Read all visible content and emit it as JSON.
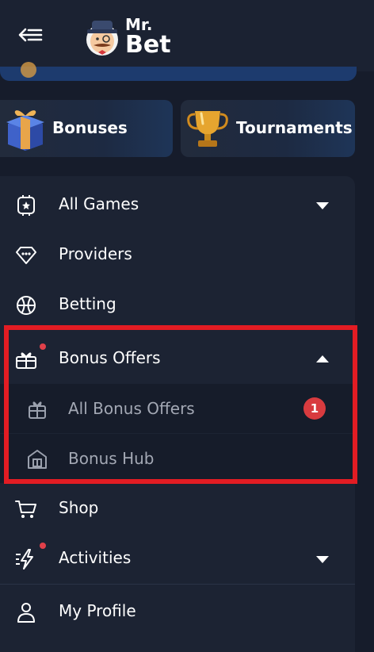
{
  "header": {
    "logo_line1": "Mr.",
    "logo_line2": "Bet"
  },
  "promos": [
    {
      "label": "Bonuses",
      "icon": "gift-box-icon"
    },
    {
      "label": "Tournaments",
      "icon": "trophy-icon"
    }
  ],
  "menu": {
    "all_games": "All Games",
    "providers": "Providers",
    "betting": "Betting",
    "bonus_offers": "Bonus Offers",
    "all_bonus_offers": "All Bonus Offers",
    "all_bonus_offers_badge": "1",
    "bonus_hub": "Bonus Hub",
    "shop": "Shop",
    "activities": "Activities",
    "my_profile": "My Profile"
  },
  "colors": {
    "background": "#161c2b",
    "menu_panel": "#1c2333",
    "badge": "#d83b3f",
    "highlight_border": "#e31c23",
    "notification_dot": "#e0404a"
  }
}
